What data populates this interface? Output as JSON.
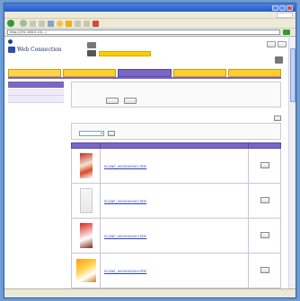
{
  "window": {
    "title": ""
  },
  "menu": [
    "",
    "",
    "",
    "",
    ""
  ],
  "toolbar": {
    "back_label": ""
  },
  "address": {
    "url": "http://192.168.0.10/.../",
    "go_label": ""
  },
  "header": {
    "brand": "",
    "app_name": "Web Connection",
    "sub": "",
    "device_line1": "",
    "device_line2": "",
    "top_button_label": ""
  },
  "tabs": [
    "",
    "",
    "",
    "",
    ""
  ],
  "sidebar": {
    "items": [
      "",
      "",
      ""
    ]
  },
  "info": {
    "rows": [
      [
        "",
        "",
        "",
        ""
      ],
      [
        "",
        "",
        "",
        ""
      ]
    ],
    "button_row_label": "",
    "buttons": [
      "",
      ""
    ]
  },
  "files_section": {
    "title": "",
    "right_label": "",
    "right_button": "",
    "note": "",
    "sort_label": "",
    "sort_value": "",
    "sort_button": "",
    "columns": [
      "",
      "",
      ""
    ],
    "rows": [
      {
        "name": "SCANF_0000000001.PDF",
        "action": ""
      },
      {
        "name": "SCANF_0000000002.PDF",
        "action": ""
      },
      {
        "name": "SCANF_0000000003.PDF",
        "action": ""
      },
      {
        "name": "SCANF_0000000004.PDF",
        "action": ""
      }
    ]
  },
  "status": {
    "left": "",
    "right": ""
  },
  "colors": {
    "tab_active": "#7a66c4",
    "tab": "#ffcc33",
    "link": "#2a3fc0"
  }
}
